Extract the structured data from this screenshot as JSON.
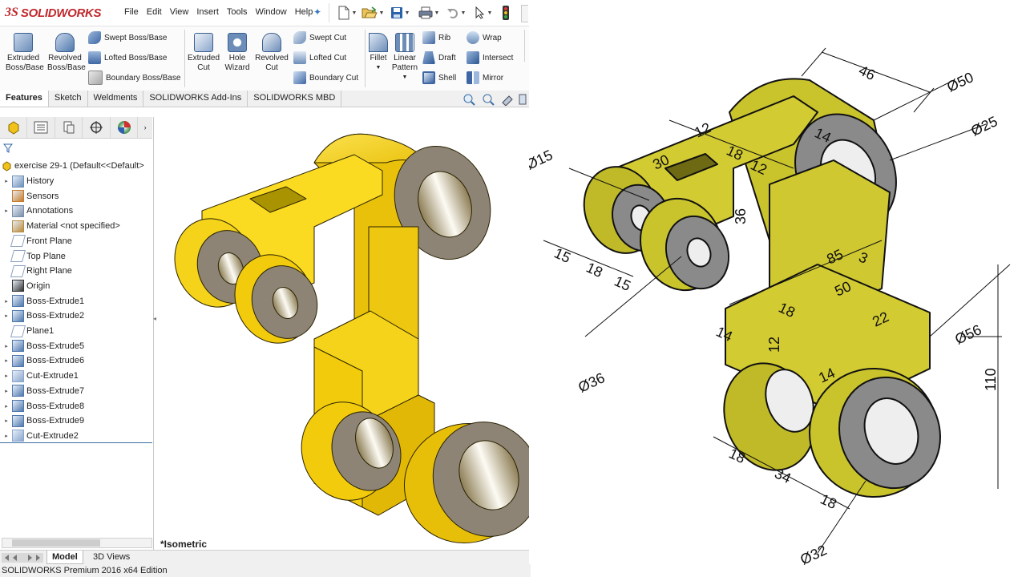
{
  "app": {
    "logo_prefix": "3S",
    "logo_text": "SOLIDWORKS"
  },
  "menu": [
    "File",
    "Edit",
    "View",
    "Insert",
    "Tools",
    "Window",
    "Help"
  ],
  "ribbon": {
    "extruded_boss": "Extruded Boss/Base",
    "revolved_boss": "Revolved Boss/Base",
    "swept_boss": "Swept Boss/Base",
    "lofted_boss": "Lofted Boss/Base",
    "boundary_boss": "Boundary Boss/Base",
    "extruded_cut": "Extruded Cut",
    "hole_wizard": "Hole Wizard",
    "revolved_cut": "Revolved Cut",
    "swept_cut": "Swept Cut",
    "lofted_cut": "Lofted Cut",
    "boundary_cut": "Boundary Cut",
    "fillet": "Fillet",
    "linear_pattern": "Linear Pattern",
    "rib": "Rib",
    "draft": "Draft",
    "shell": "Shell",
    "wrap": "Wrap",
    "intersect": "Intersect",
    "mirror": "Mirror"
  },
  "tabs": [
    "Features",
    "Sketch",
    "Weldments",
    "SOLIDWORKS Add-Ins",
    "SOLIDWORKS MBD"
  ],
  "tree": {
    "root": "exercise 29-1  (Default<<Default>",
    "items": [
      {
        "label": "History",
        "icon": "history-icon",
        "expand": true
      },
      {
        "label": "Sensors",
        "icon": "sensors-icon",
        "expand": false
      },
      {
        "label": "Annotations",
        "icon": "annotations-icon",
        "expand": true
      },
      {
        "label": "Material <not specified>",
        "icon": "material-icon",
        "expand": false
      },
      {
        "label": "Front Plane",
        "icon": "plane-icon",
        "expand": false
      },
      {
        "label": "Top Plane",
        "icon": "plane-icon",
        "expand": false
      },
      {
        "label": "Right Plane",
        "icon": "plane-icon",
        "expand": false
      },
      {
        "label": "Origin",
        "icon": "origin-icon",
        "expand": false
      },
      {
        "label": "Boss-Extrude1",
        "icon": "extrude-icon",
        "expand": true
      },
      {
        "label": "Boss-Extrude2",
        "icon": "extrude-icon",
        "expand": true
      },
      {
        "label": "Plane1",
        "icon": "plane-icon",
        "expand": false
      },
      {
        "label": "Boss-Extrude5",
        "icon": "extrude-icon",
        "expand": true
      },
      {
        "label": "Boss-Extrude6",
        "icon": "extrude-icon",
        "expand": true
      },
      {
        "label": "Cut-Extrude1",
        "icon": "cut-icon",
        "expand": true
      },
      {
        "label": "Boss-Extrude7",
        "icon": "extrude-icon",
        "expand": true
      },
      {
        "label": "Boss-Extrude8",
        "icon": "extrude-icon",
        "expand": true
      },
      {
        "label": "Boss-Extrude9",
        "icon": "extrude-icon",
        "expand": true
      },
      {
        "label": "Cut-Extrude2",
        "icon": "cut-icon",
        "expand": true
      }
    ]
  },
  "viewport": {
    "view_label": "*Isometric"
  },
  "bottom_tabs": [
    "Model",
    "3D Views"
  ],
  "status": "SOLIDWORKS Premium 2016 x64 Edition",
  "drawing": {
    "dims": [
      "46",
      "Ø50",
      "Ø25",
      "Ø15",
      "12",
      "18",
      "12",
      "14",
      "30",
      "36",
      "15",
      "18",
      "15",
      "85",
      "3",
      "50",
      "18",
      "22",
      "14",
      "12",
      "14",
      "Ø36",
      "Ø56",
      "110",
      "18",
      "34",
      "18",
      "Ø32"
    ]
  },
  "colors": {
    "part_yellow": "#f2cc0c",
    "drawing_olive": "#c9c32c",
    "accent_blue": "#3a6ea5"
  }
}
